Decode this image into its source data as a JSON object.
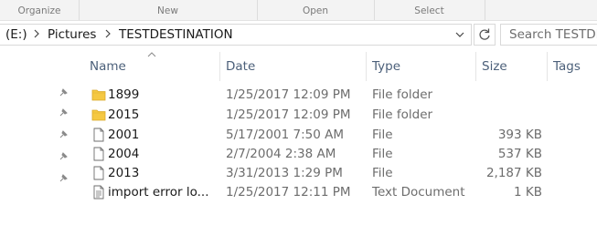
{
  "ribbon": {
    "groups": [
      "Organize",
      "New",
      "Open",
      "Select"
    ]
  },
  "address": {
    "drive": "(E:)",
    "folder1": "Pictures",
    "folder2": "TESTDESTINATION"
  },
  "search": {
    "placeholder": "Search TESTDESTINATION"
  },
  "columns": {
    "name": "Name",
    "date": "Date",
    "type": "Type",
    "size": "Size",
    "tags": "Tags"
  },
  "rows": [
    {
      "name": "1899",
      "date": "1/25/2017 12:09 PM",
      "type": "File folder",
      "size": "",
      "icon": "folder-icon"
    },
    {
      "name": "2015",
      "date": "1/25/2017 12:09 PM",
      "type": "File folder",
      "size": "",
      "icon": "folder-icon"
    },
    {
      "name": "2001",
      "date": "5/17/2001 7:50 AM",
      "type": "File",
      "size": "393 KB",
      "icon": "file-icon"
    },
    {
      "name": "2004",
      "date": "2/7/2004 2:38 AM",
      "type": "File",
      "size": "537 KB",
      "icon": "file-icon"
    },
    {
      "name": "2013",
      "date": "3/31/2013 1:29 PM",
      "type": "File",
      "size": "2,187 KB",
      "icon": "file-icon"
    },
    {
      "name": "import error lo...",
      "date": "1/25/2017 12:11 PM",
      "type": "Text Document",
      "size": "1 KB",
      "icon": "text-document-icon"
    }
  ],
  "colors": {
    "folder": "#f5c842",
    "header_text": "#4c607a",
    "muted_text": "#6d6d6d"
  }
}
